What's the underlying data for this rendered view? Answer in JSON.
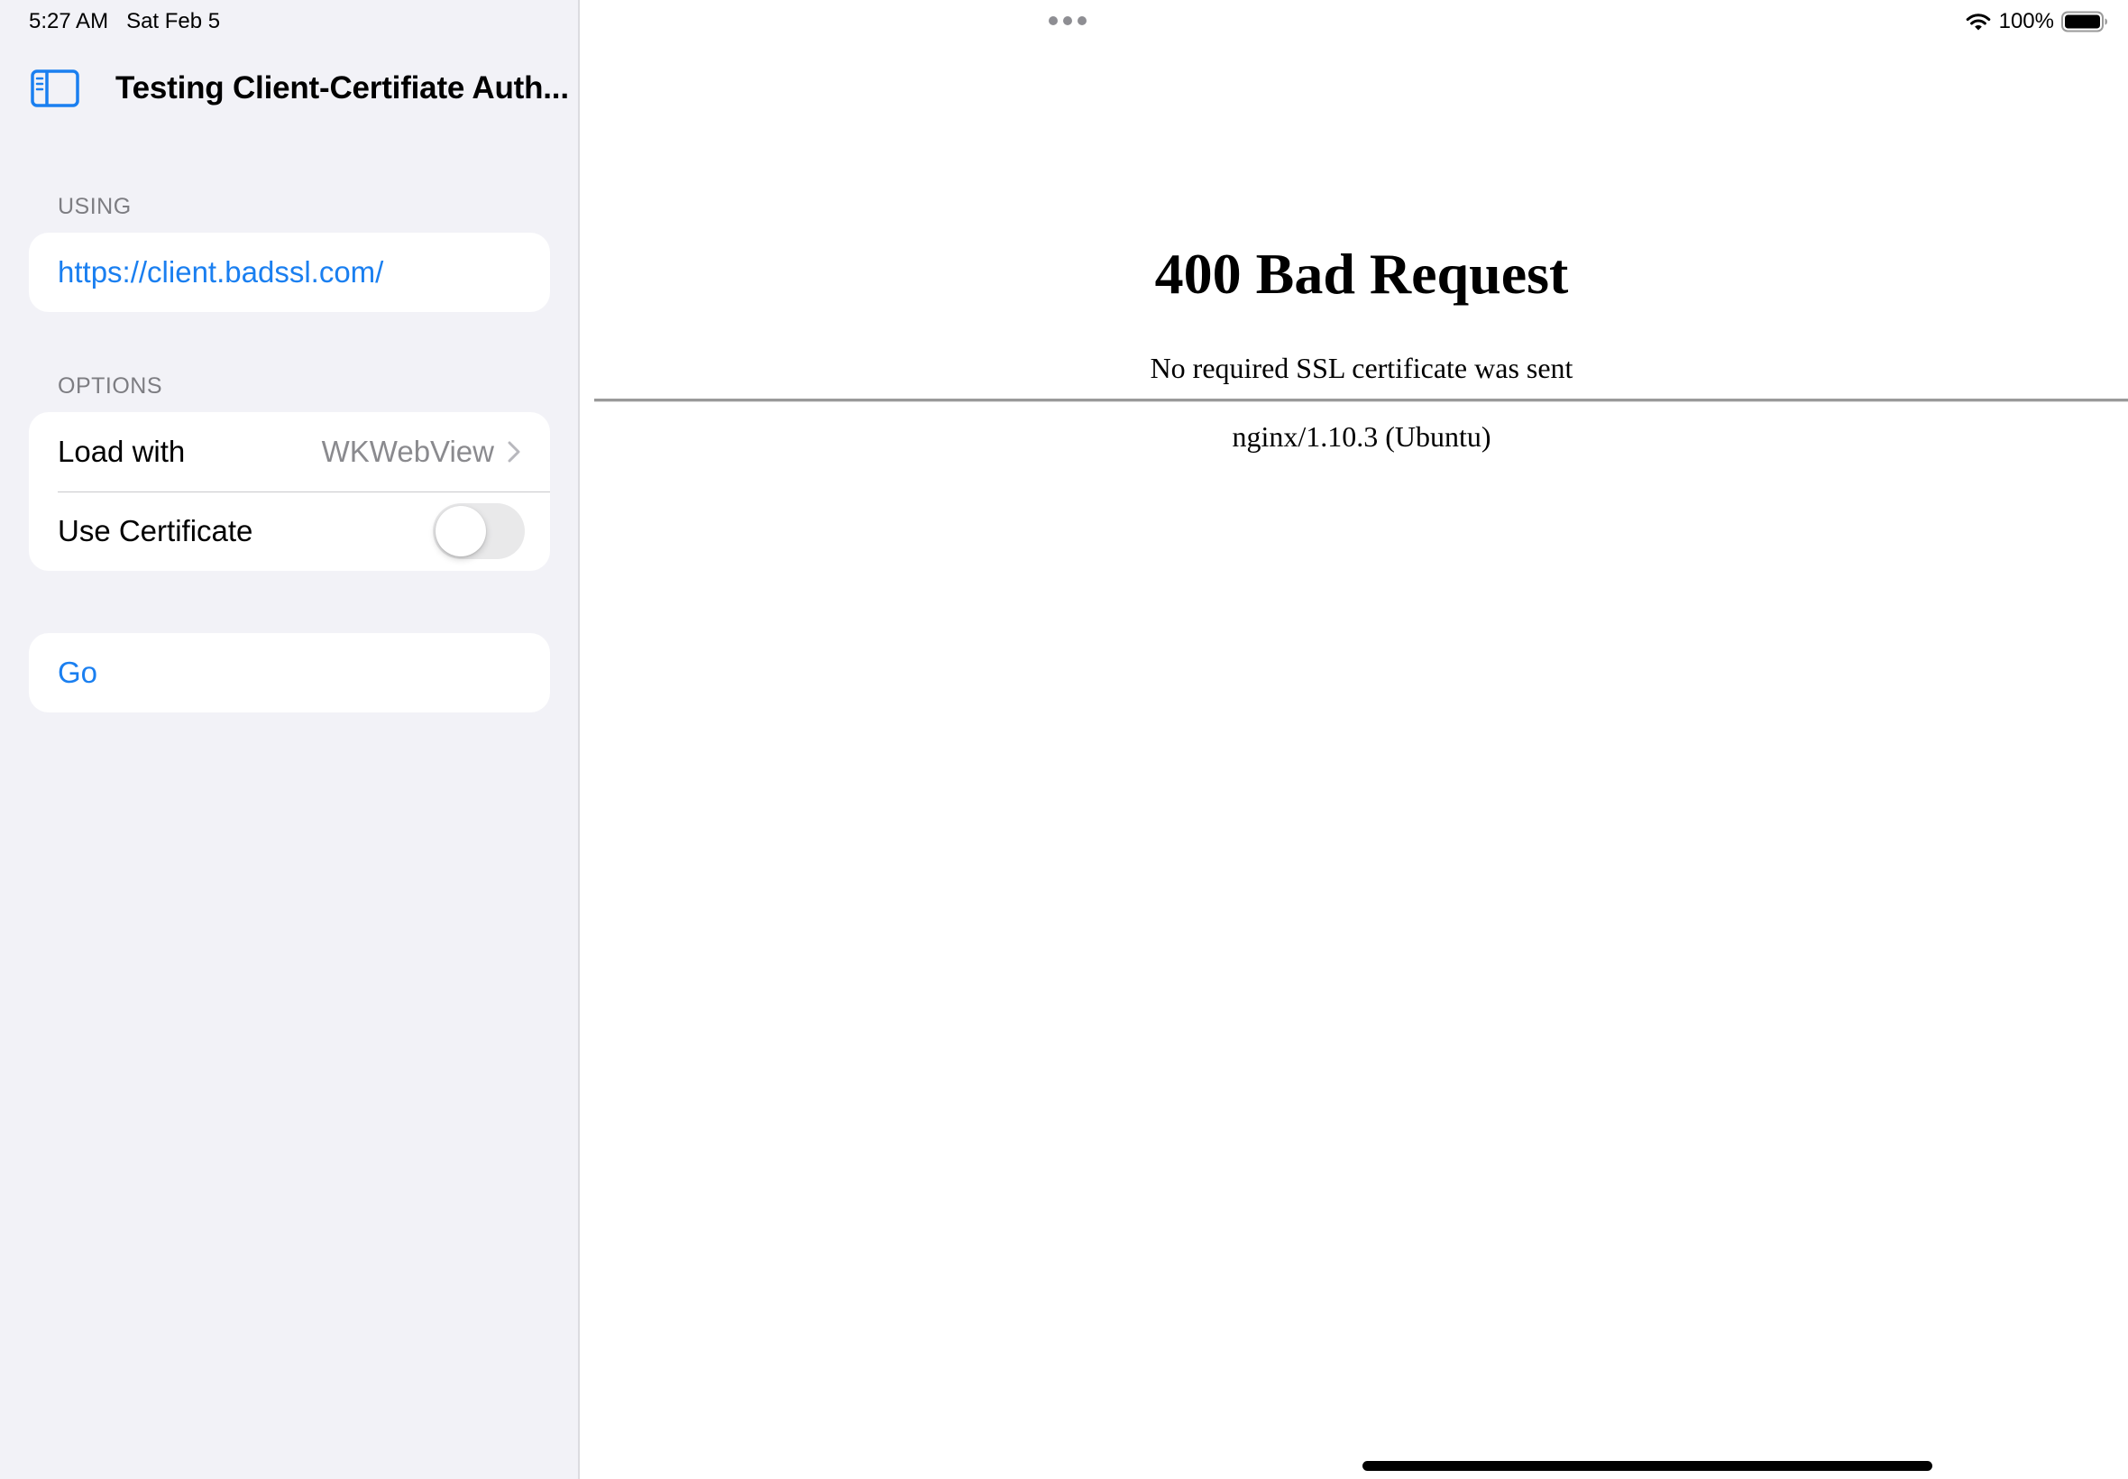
{
  "status_bar": {
    "time": "5:27 AM",
    "date": "Sat Feb 5",
    "battery": "100%",
    "icons": [
      "wifi-icon",
      "battery-icon"
    ]
  },
  "sidebar": {
    "title": "Testing Client-Certifiate Auth...",
    "toggle_icon": "sidebar-icon",
    "using_header": "USING",
    "url": "https://client.badssl.com/",
    "options_header": "OPTIONS",
    "load_with_label": "Load with",
    "load_with_value": "WKWebView",
    "use_certificate_label": "Use Certificate",
    "use_certificate_enabled": false,
    "go_label": "Go"
  },
  "web": {
    "heading": "400 Bad Request",
    "message": "No required SSL certificate was sent",
    "server": "nginx/1.10.3 (Ubuntu)"
  },
  "colors": {
    "accent": "#1a7ff0",
    "sidebar_bg": "#f2f2f7",
    "secondary_text": "#8a8a8e"
  }
}
